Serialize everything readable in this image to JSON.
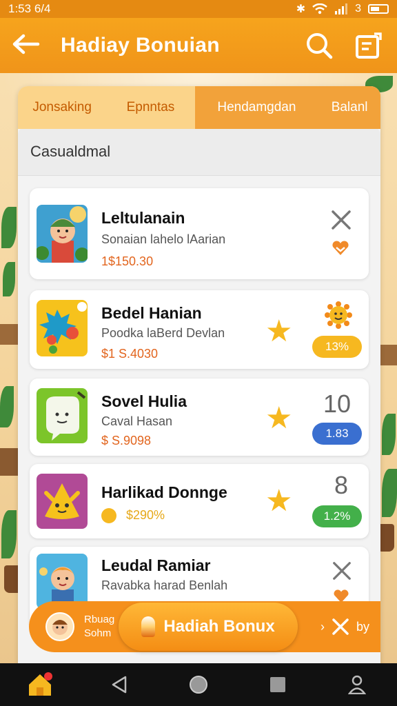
{
  "status": {
    "time": "1:53",
    "extra": "6/4",
    "battery_text": "3"
  },
  "appbar": {
    "title": "Hadiay Bonuian"
  },
  "tabs": [
    {
      "label": "Jonsaking",
      "active": false
    },
    {
      "label": "Epnntas",
      "active": false
    },
    {
      "label": "Hendamgdan",
      "active": true
    },
    {
      "label": "Balanl",
      "active": false
    }
  ],
  "section": {
    "heading": "Casualdmal"
  },
  "cards": [
    {
      "name": "Leltulanain",
      "subtitle": "Sonaian lahelo lAarian",
      "price": "1$150.30",
      "right_badge": ""
    },
    {
      "name": "Bedel Hanian",
      "subtitle": "Poodka laBerd Devlan",
      "price": "$1 S.4030",
      "right_badge": "13%"
    },
    {
      "name": "Sovel Hulia",
      "subtitle": "Caval Hasan",
      "price": "$ S.9098",
      "right_number": "10",
      "right_badge": "1.83"
    },
    {
      "name": "Harlikad Donnge",
      "subtitle": "",
      "price": "$290%",
      "right_number": "8",
      "right_badge": "1.2%"
    },
    {
      "name": "Leudal Ramiar",
      "subtitle": "Ravabka harad Benlah",
      "price": "",
      "right_badge": ""
    }
  ],
  "bonus": {
    "mini_line1": "Rbuag",
    "mini_line2": "Sohm",
    "button_label": "Hadiah Bonux",
    "right_text": "by"
  },
  "colors": {
    "accent": "#f0941a",
    "price": "#e2651e",
    "badge_yellow": "#f6b820",
    "badge_blue": "#3a6fd0",
    "badge_green": "#43b04a"
  }
}
